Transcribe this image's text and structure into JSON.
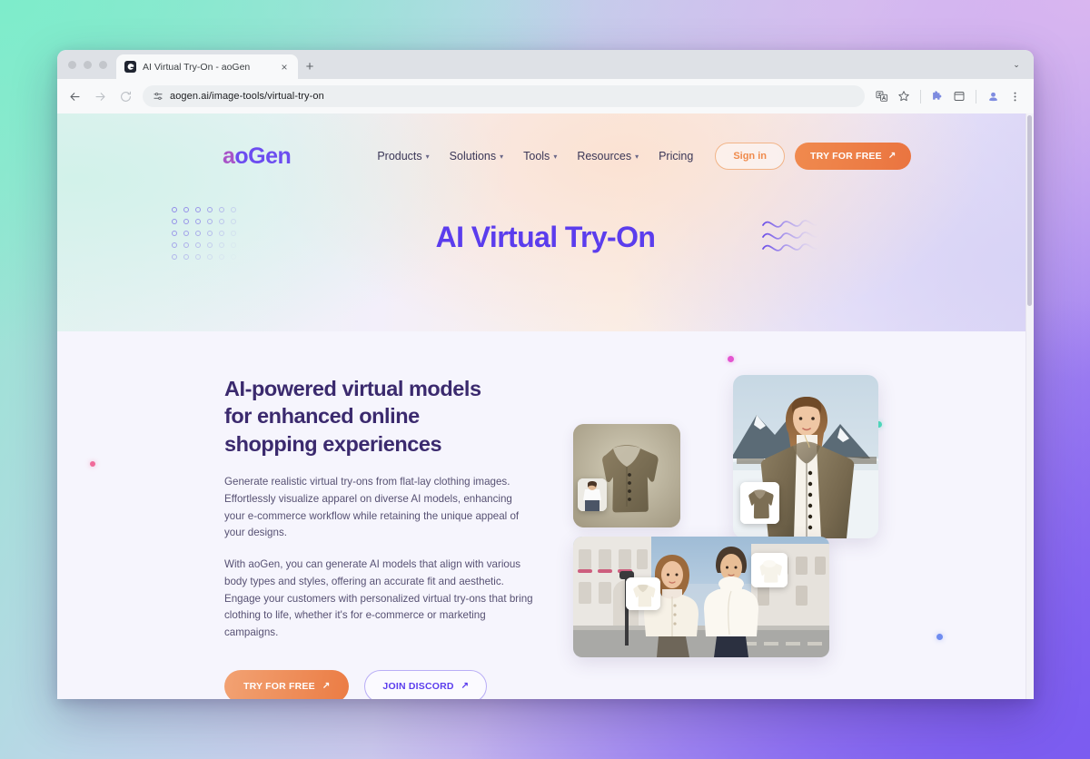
{
  "browser": {
    "tab": {
      "title": "AI Virtual Try-On - aoGen",
      "favicon_name": "aogen-favicon",
      "close_label": "×",
      "newtab_label": "+"
    },
    "toolbar": {
      "back_label": "←",
      "forward_label": "→",
      "reload_label": "↻",
      "url": "aogen.ai/image-tools/virtual-try-on",
      "site_icon_name": "site-settings-icon",
      "translate_icon_name": "translate-icon",
      "bookmark_icon_name": "star-icon",
      "extensions_icon_name": "puzzle-icon",
      "split_icon_name": "split-screen-icon",
      "profile_icon_name": "profile-avatar-icon",
      "menu_icon_name": "three-dot-menu-icon"
    },
    "window_chevron": "⌄"
  },
  "site": {
    "logo": {
      "mark": "a",
      "text": "oGen",
      "full": "aoGen"
    },
    "nav": [
      {
        "label": "Products",
        "has_dropdown": true
      },
      {
        "label": "Solutions",
        "has_dropdown": true
      },
      {
        "label": "Tools",
        "has_dropdown": true
      },
      {
        "label": "Resources",
        "has_dropdown": true
      },
      {
        "label": "Pricing",
        "has_dropdown": false
      }
    ],
    "caret": "▾",
    "actions": {
      "signin": "Sign in",
      "try_free": "TRY FOR FREE",
      "arrow": "↗"
    },
    "hero": {
      "title": "AI Virtual Try-On"
    },
    "main": {
      "heading_line1": "AI-powered virtual models",
      "heading_line2": "for enhanced online",
      "heading_line3": "shopping experiences",
      "paragraph1": "Generate realistic virtual try-ons from flat-lay clothing images. Effortlessly visualize apparel on diverse AI models, enhancing your e-commerce workflow while retaining the unique appeal of your designs.",
      "paragraph2": "With aoGen, you can generate AI models that align with various body types and styles, offering an accurate fit and aesthetic. Engage your customers with personalized virtual try-ons that bring clothing to life, whether it's for e-commerce or marketing campaigns.",
      "cta_primary": "TRY FOR FREE",
      "cta_secondary": "JOIN DISCORD",
      "arrow": "↗"
    },
    "media": {
      "flat_lay_alt": "brown teddy coat flat lay",
      "model_alt": "model wearing brown teddy coat in snowy mountains",
      "street_alt": "two models wearing cream jackets on a city street"
    }
  },
  "colors": {
    "brand_purple": "#5b3ded",
    "brand_orange": "#eb7c44",
    "heading_ink": "#3b2a6e",
    "body_ink": "#575173",
    "page_bg": "#f6f5fd",
    "accent_pink": "#e455d0",
    "accent_teal": "#4fe0c0",
    "accent_orange": "#f0a855",
    "accent_blue": "#6f8cf0",
    "accent_rose": "#f06a9a"
  }
}
